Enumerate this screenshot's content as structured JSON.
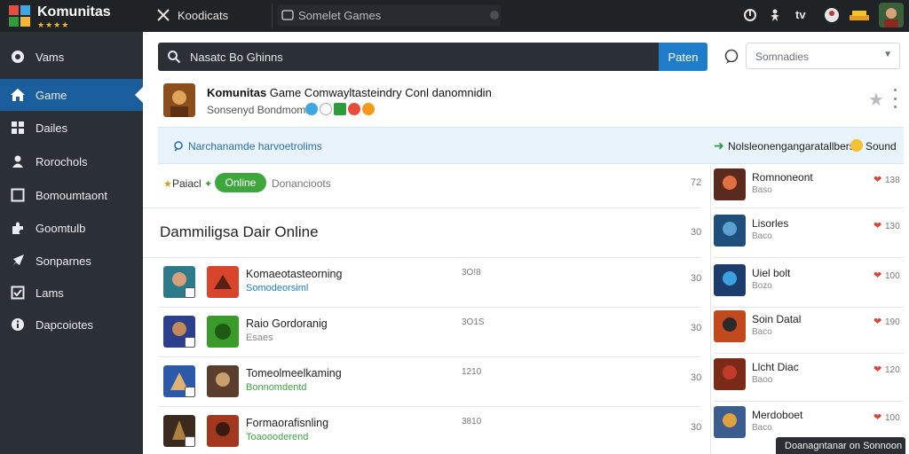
{
  "app": {
    "name": "Komunitas",
    "rating_stars": "★★★★",
    "top_nav_label": "Koodicats",
    "top_search_placeholder": "Somelet Games",
    "top_tv_label": "tv"
  },
  "sidebar": {
    "items": [
      {
        "label": "Vams",
        "icon": "disc-icon",
        "active": false
      },
      {
        "label": "Game",
        "icon": "home-icon",
        "active": true
      },
      {
        "label": "Dailes",
        "icon": "grid-icon",
        "active": false
      },
      {
        "label": "Rorochols",
        "icon": "person-icon",
        "active": false
      },
      {
        "label": "Bomoumtaont",
        "icon": "window-icon",
        "active": false
      },
      {
        "label": "Goomtulb",
        "icon": "puzzle-icon",
        "active": false
      },
      {
        "label": "Sonparnes",
        "icon": "rocket-icon",
        "active": false
      },
      {
        "label": "Lams",
        "icon": "check-box-icon",
        "active": false
      },
      {
        "label": "Dapcoiotes",
        "icon": "info-icon",
        "active": false
      }
    ]
  },
  "search": {
    "value": "Nasatc Bo Ghinns",
    "button_label": "Paten"
  },
  "sort": {
    "selected": "Somnadies"
  },
  "header_card": {
    "title_bold": "Komunitas",
    "title_rest": "Game Comwayltasteindry Conl danomnidin",
    "subtitle": "Sonsenyd Bondmoms"
  },
  "notice": {
    "label": "Narchanamde harvoetrolims",
    "right_label": "Nolsleonengangaratallbers",
    "sound_label": "Sound"
  },
  "filters": {
    "label": "Paiacl",
    "online_label": "Online",
    "more_label": "Donancioots",
    "count": "72"
  },
  "section": {
    "title": "Dammiligsa Dair Online",
    "count": "30"
  },
  "rows": [
    {
      "title": "Komaeotasteorning",
      "subtitle": "Somodeorsiml",
      "subtitle_color": "#1f7cc9",
      "stat": "3O!8",
      "count": "30",
      "thumb_a": "#2d7b8a",
      "thumb_b": "#d9452b"
    },
    {
      "title": "Raio Gordoranig",
      "subtitle": "Esaes",
      "subtitle_color": "#888888",
      "stat": "3O1S",
      "count": "30",
      "thumb_a": "#2b3f8c",
      "thumb_b": "#3a9a2a"
    },
    {
      "title": "Tomeolmeelkaming",
      "subtitle": "Bonnomdentd",
      "subtitle_color": "#3da73d",
      "stat": "1210",
      "count": "30",
      "thumb_a": "#2c5aa8",
      "thumb_b": "#5a3d2c"
    },
    {
      "title": "Formaorafisnling",
      "subtitle": "Toaoooderend",
      "subtitle_color": "#3da73d",
      "stat": "3810",
      "count": "30",
      "thumb_a": "#3b2b1f",
      "thumb_b": "#a2381e"
    }
  ],
  "panel": [
    {
      "title": "Romnoneont",
      "subtitle": "Baso",
      "count": "138",
      "thumb": "#5a2a1e"
    },
    {
      "title": "Lisorles",
      "subtitle": "Baco",
      "count": "130",
      "thumb": "#1d4f7a"
    },
    {
      "title": "Uiel bolt",
      "subtitle": "Bozo",
      "count": "100",
      "thumb": "#1c3c6b"
    },
    {
      "title": "Soin Datal",
      "subtitle": "Baco",
      "count": "190",
      "thumb": "#c2481d"
    },
    {
      "title": "Llcht Diac",
      "subtitle": "Baoo",
      "count": "120",
      "thumb": "#7a2a16"
    },
    {
      "title": "Merdoboet",
      "subtitle": "Baco",
      "count": "100",
      "thumb": "#3b5c8e"
    }
  ],
  "toast": {
    "label": "Doanagntanar on Sonnoon"
  },
  "colors": {
    "topbar": "#1f2326",
    "sidebar": "#2b3036",
    "accent": "#1f7cc9",
    "online": "#3da73d"
  }
}
